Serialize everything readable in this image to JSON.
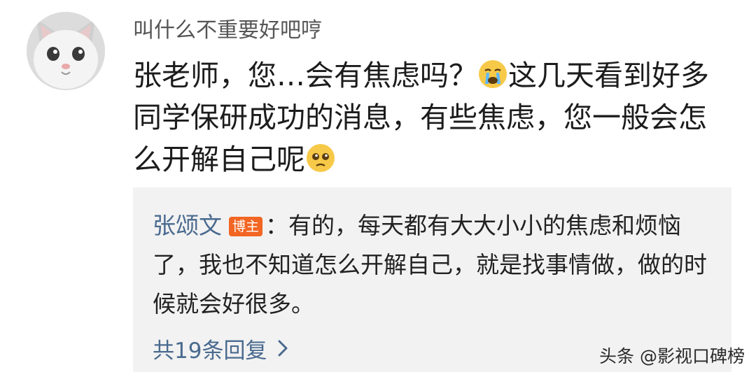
{
  "comment": {
    "username": "叫什么不重要好吧哼",
    "text_part1": "张老师，您…会有焦虑吗？",
    "emoji_1": "crying-face-emoji",
    "text_part2": "这几天看到好多同学保研成功的消息，有些焦虑，您一般会怎么开解自己呢",
    "emoji_2": "pleading-face-emoji"
  },
  "reply": {
    "author": "张颂文",
    "badge": "博主",
    "separator": "：",
    "text": "有的，每天都有大大小小的焦虑和烦恼了，我也不知道怎么开解自己，就是找事情做，做的时候就会好很多。",
    "more_label": "共19条回复",
    "more_icon": "chevron-right-icon"
  },
  "watermark": "头条 @影视口碑榜",
  "colors": {
    "link": "#4a6a8f",
    "badge": "#f26522",
    "reply_bg": "#f2f2f2"
  }
}
